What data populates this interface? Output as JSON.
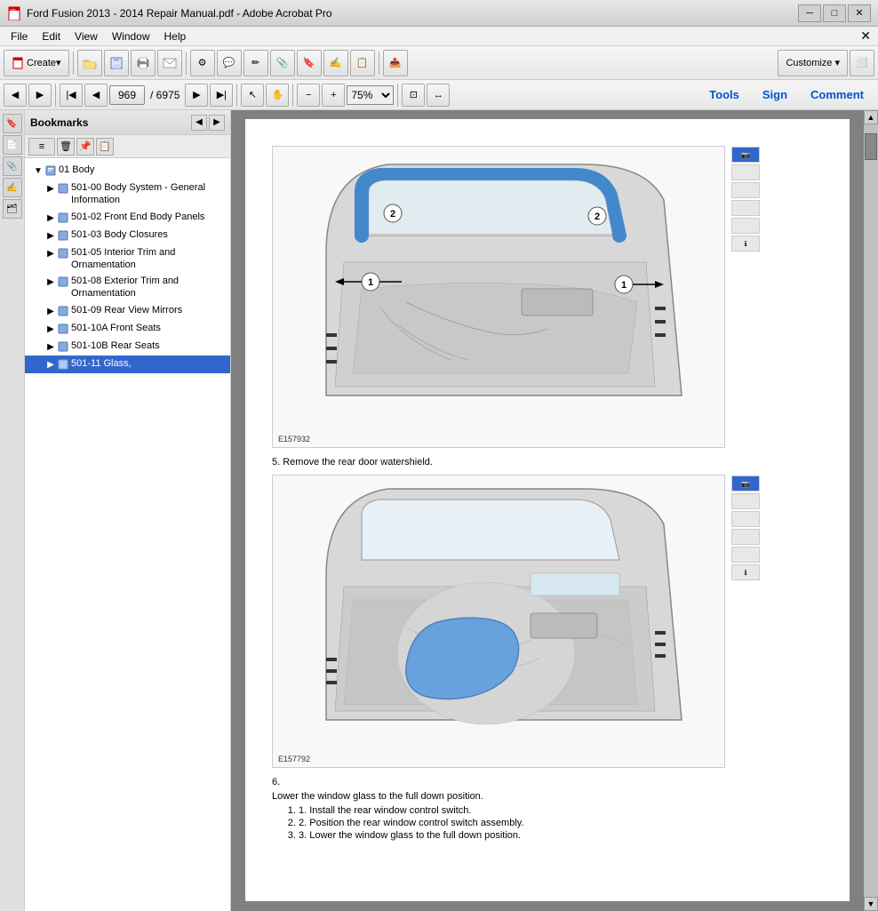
{
  "window": {
    "title": "Ford Fusion 2013 - 2014 Repair Manual.pdf - Adobe Acrobat Pro",
    "icon": "pdf-icon"
  },
  "menu": {
    "items": [
      "File",
      "Edit",
      "View",
      "Window",
      "Help"
    ],
    "close_x": "✕"
  },
  "toolbar": {
    "create_label": "Create",
    "customize_label": "Customize ▾"
  },
  "toolbar2": {
    "page_current": "969",
    "page_separator": "/",
    "page_total": "6975",
    "zoom": "75%",
    "tools_label": "Tools",
    "sign_label": "Sign",
    "comment_label": "Comment"
  },
  "sidebar": {
    "title": "Bookmarks",
    "items": [
      {
        "id": "01-body",
        "label": "01 Body",
        "indent": 0,
        "expanded": true
      },
      {
        "id": "501-00",
        "label": "501-00 Body System - General Information",
        "indent": 1,
        "expanded": false
      },
      {
        "id": "501-02",
        "label": "501-02 Front End Body Panels",
        "indent": 1,
        "expanded": false
      },
      {
        "id": "501-03",
        "label": "501-03 Body Closures",
        "indent": 1,
        "expanded": false
      },
      {
        "id": "501-05",
        "label": "501-05 Interior Trim and Ornamentation",
        "indent": 1,
        "expanded": false
      },
      {
        "id": "501-08",
        "label": "501-08 Exterior Trim and Ornamentation",
        "indent": 1,
        "expanded": false
      },
      {
        "id": "501-09",
        "label": "501-09 Rear View Mirrors",
        "indent": 1,
        "expanded": false
      },
      {
        "id": "501-10a",
        "label": "501-10A Front Seats",
        "indent": 1,
        "expanded": false
      },
      {
        "id": "501-10b",
        "label": "501-10B Rear Seats",
        "indent": 1,
        "expanded": false
      },
      {
        "id": "501-11",
        "label": "501-11 Glass,",
        "indent": 1,
        "expanded": false,
        "selected": true
      }
    ]
  },
  "content": {
    "step5_text": "5. Remove the rear door watershield.",
    "step6_text": "6.",
    "step6_sub_text": "Lower the window glass to the full down position.",
    "step6_sub1": "1. Install the rear window control switch.",
    "step6_sub2": "2. Position the rear window control switch assembly.",
    "step6_sub3": "3. Lower the window glass to the full down position.",
    "figure1_label": "E157932",
    "figure2_label": "E157792"
  }
}
